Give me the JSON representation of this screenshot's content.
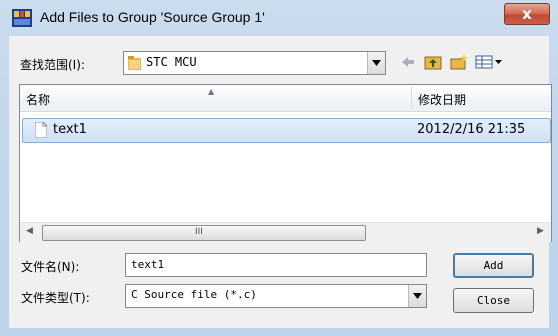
{
  "window": {
    "title": "Add Files to Group 'Source Group 1'",
    "close_glyph": "x"
  },
  "lookin": {
    "label": "查找范围(I):",
    "value": "STC MCU"
  },
  "toolbar": {
    "icons": [
      "back-icon",
      "up-folder-icon",
      "new-folder-icon",
      "view-menu-icon"
    ]
  },
  "list": {
    "columns": {
      "name": "名称",
      "date": "修改日期"
    },
    "rows": [
      {
        "name": "text1",
        "date": "2012/2/16 21:35"
      }
    ],
    "scroll_grip": "III"
  },
  "filename": {
    "label": "文件名(N):",
    "value": "text1"
  },
  "filetype": {
    "label": "文件类型(T):",
    "value": "C Source file (*.c)"
  },
  "buttons": {
    "add": "Add",
    "close": "Close"
  },
  "colors": {
    "title_bar": "#c2d6ec",
    "selection": "#cfe0f5",
    "close_button": "#c94f38"
  }
}
